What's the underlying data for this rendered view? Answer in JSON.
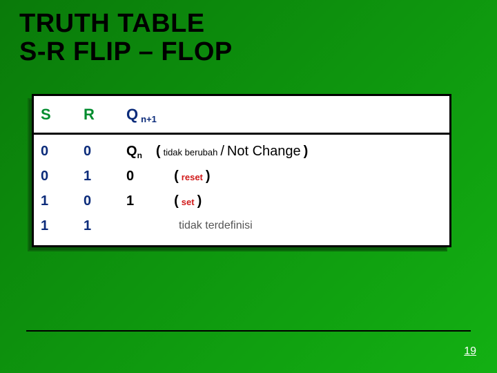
{
  "title_line1": "TRUTH TABLE",
  "title_line2": "S-R  FLIP – FLOP",
  "header": {
    "s": "S",
    "r": "R",
    "q": "Q",
    "qsub": "n+1"
  },
  "rows": [
    {
      "s": "0",
      "r": "0",
      "out_main": "Q",
      "out_sub": "n",
      "p_open": "(",
      "note_small": "tidak berubah",
      "slash": "/",
      "note_big": "Not Change",
      "p_close": ")"
    },
    {
      "s": "0",
      "r": "1",
      "out_main": "0",
      "p_open": "(",
      "note_red": "reset",
      "p_close": ")"
    },
    {
      "s": "1",
      "r": "0",
      "out_main": "1",
      "p_open": "(",
      "note_red": "set",
      "p_close": ")"
    },
    {
      "s": "1",
      "r": "1",
      "undef": "tidak terdefinisi"
    }
  ],
  "page_number": "19",
  "chart_data": {
    "type": "table",
    "title": "TRUTH TABLE S-R FLIP – FLOP",
    "columns": [
      "S",
      "R",
      "Q_{n+1}"
    ],
    "rows": [
      [
        "0",
        "0",
        "Q_n (tidak berubah / Not Change)"
      ],
      [
        "0",
        "1",
        "0 (reset)"
      ],
      [
        "1",
        "0",
        "1 (set)"
      ],
      [
        "1",
        "1",
        "tidak terdefinisi"
      ]
    ]
  }
}
